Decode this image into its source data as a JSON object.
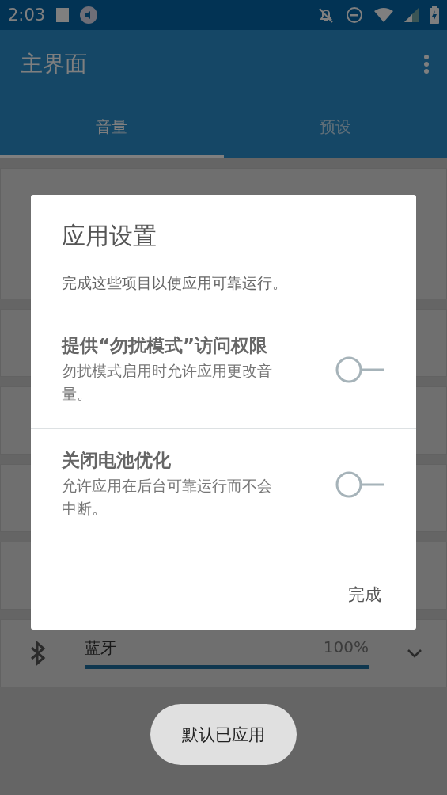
{
  "status_bar": {
    "time": "2:03"
  },
  "app_bar": {
    "title": "主界面"
  },
  "tabs": [
    {
      "label": "音量",
      "selected": true
    },
    {
      "label": "预设",
      "selected": false
    }
  ],
  "volume_cards": [
    {
      "kind": "blank"
    },
    {
      "kind": "blank"
    },
    {
      "kind": "blank"
    },
    {
      "kind": "blank"
    },
    {
      "kind": "blank"
    },
    {
      "kind": "bluetooth",
      "label": "蓝牙",
      "reading": "100%",
      "level": 1
    }
  ],
  "dialog": {
    "title": "应用设置",
    "message": "完成这些项目以使应用可靠运行。",
    "items": [
      {
        "title": "提供“勿扰模式”访问权限",
        "description": "勿扰模式启用时允许应用更改音量。",
        "on": false
      },
      {
        "title": "关闭电池优化",
        "description": "允许应用在后台可靠运行而不会中断。",
        "on": false
      }
    ],
    "button": "完成"
  },
  "toast": "默认已应用"
}
